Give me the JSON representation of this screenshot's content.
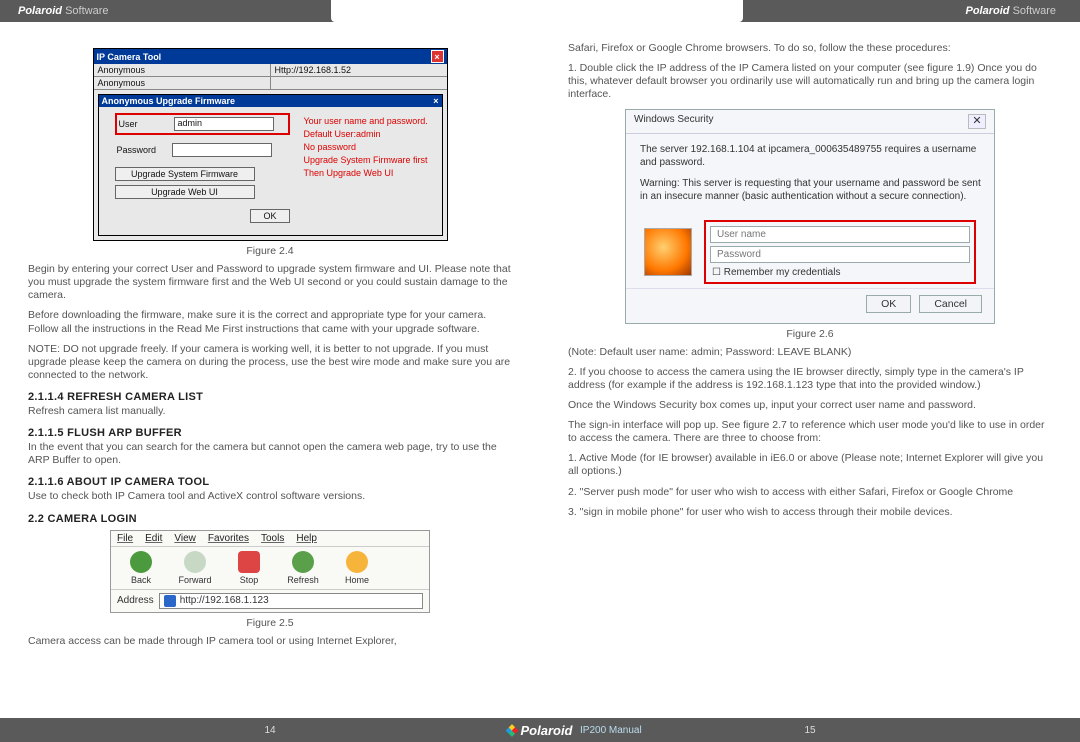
{
  "header": {
    "brand": "Polaroid",
    "suffix": " Software"
  },
  "footer": {
    "brand": "Polaroid",
    "manual": "IP200 Manual",
    "pageL": "14",
    "pageR": "15"
  },
  "fig24": {
    "title": "IP Camera Tool",
    "row1a": "Anonymous",
    "row1b": "Http://192.168.1.52",
    "row2a": "Anonymous",
    "dlgTitle": "Anonymous Upgrade Firmware",
    "userLabel": "User",
    "userValue": "admin",
    "passLabel": "Password",
    "passValue": "",
    "btnSys": "Upgrade System Firmware",
    "btnWeb": "Upgrade Web UI",
    "ok": "OK",
    "caption": "Figure 2.4",
    "ann1": "Your user name and password.",
    "ann2": "Default User:admin",
    "ann3": "No password",
    "ann4": "Upgrade System Firmware first",
    "ann5": "Then Upgrade Web UI"
  },
  "p24a": "Begin by entering your correct User and Password to upgrade system firmware and UI. Please note that you must upgrade the system firmware first and the Web UI second or you could sustain damage to the camera.",
  "p24b": "Before downloading the firmware, make sure it is the correct and appropriate type for your camera. Follow all the instructions in the Read Me First instructions that came with your upgrade software.",
  "p24c": "NOTE: DO not upgrade freely. If your camera is working well, it is better to not upgrade. If you must upgrade please keep the camera on during the process, use the best wire mode and make sure you are connected to the network.",
  "h_refresh": "2.1.1.4 REFRESH CAMERA LIST",
  "p_refresh": "Refresh camera list manually.",
  "h_flush": "2.1.1.5 FLUSH ARP BUFFER",
  "p_flush": "In the event that you can search for the camera but cannot open the camera web page, try to use the ARP Buffer to open.",
  "h_about": "2.1.1.6 ABOUT IP CAMERA TOOL",
  "p_about": "Use to check both IP Camera tool and ActiveX control software versions.",
  "h_login": "2.2 CAMERA LOGIN",
  "fig25": {
    "m_file": "File",
    "m_edit": "Edit",
    "m_view": "View",
    "m_fav": "Favorites",
    "m_tools": "Tools",
    "m_help": "Help",
    "back": "Back",
    "fwd": "Forward",
    "stop": "Stop",
    "refresh": "Refresh",
    "home": "Home",
    "addrLabel": "Address",
    "addr": "http://192.168.1.123",
    "caption": "Figure 2.5"
  },
  "p25": "Camera access can be made through IP camera tool or using Internet Explorer,",
  "pR1": "Safari, Firefox or Google Chrome browsers. To do so, follow the these procedures:",
  "pR2": "1. Double click the IP address of the IP Camera listed on your computer (see figure 1.9) Once you do this, whatever default browser you ordinarily use will automatically run and bring up the camera login interface.",
  "fig26": {
    "title": "Windows Security",
    "l1": "The server 192.168.1.104 at ipcamera_000635489755 requires a username and password.",
    "l2": "Warning: This server is requesting that your username and password be sent in an insecure manner (basic authentication without a secure connection).",
    "user_ph": "User name",
    "pass_ph": "Password",
    "remember": "Remember my credentials",
    "ok": "OK",
    "cancel": "Cancel",
    "caption": "Figure 2.6"
  },
  "pR3": "(Note: Default user name: admin; Password: LEAVE BLANK)",
  "pR4": "2. If you choose to access the camera using the IE browser directly, simply type in the camera's IP address (for example if the address is 192.168.1.123 type that into the provided window.)",
  "pR5": "Once the Windows Security box comes up, input your correct user name and password.",
  "pR6": "The sign-in interface will pop up. See figure 2.7 to reference which user mode you'd like to use in order to access the camera. There are three to choose from:",
  "pR7": "1. Active Mode (for IE browser) available in iE6.0 or above (Please note; Internet Explorer will give you all options.)",
  "pR8": "2. \"Server push mode\" for user who wish to access with either Safari, Firefox or Google Chrome",
  "pR9": "3. \"sign in mobile phone\" for user who wish to access through their mobile devices."
}
